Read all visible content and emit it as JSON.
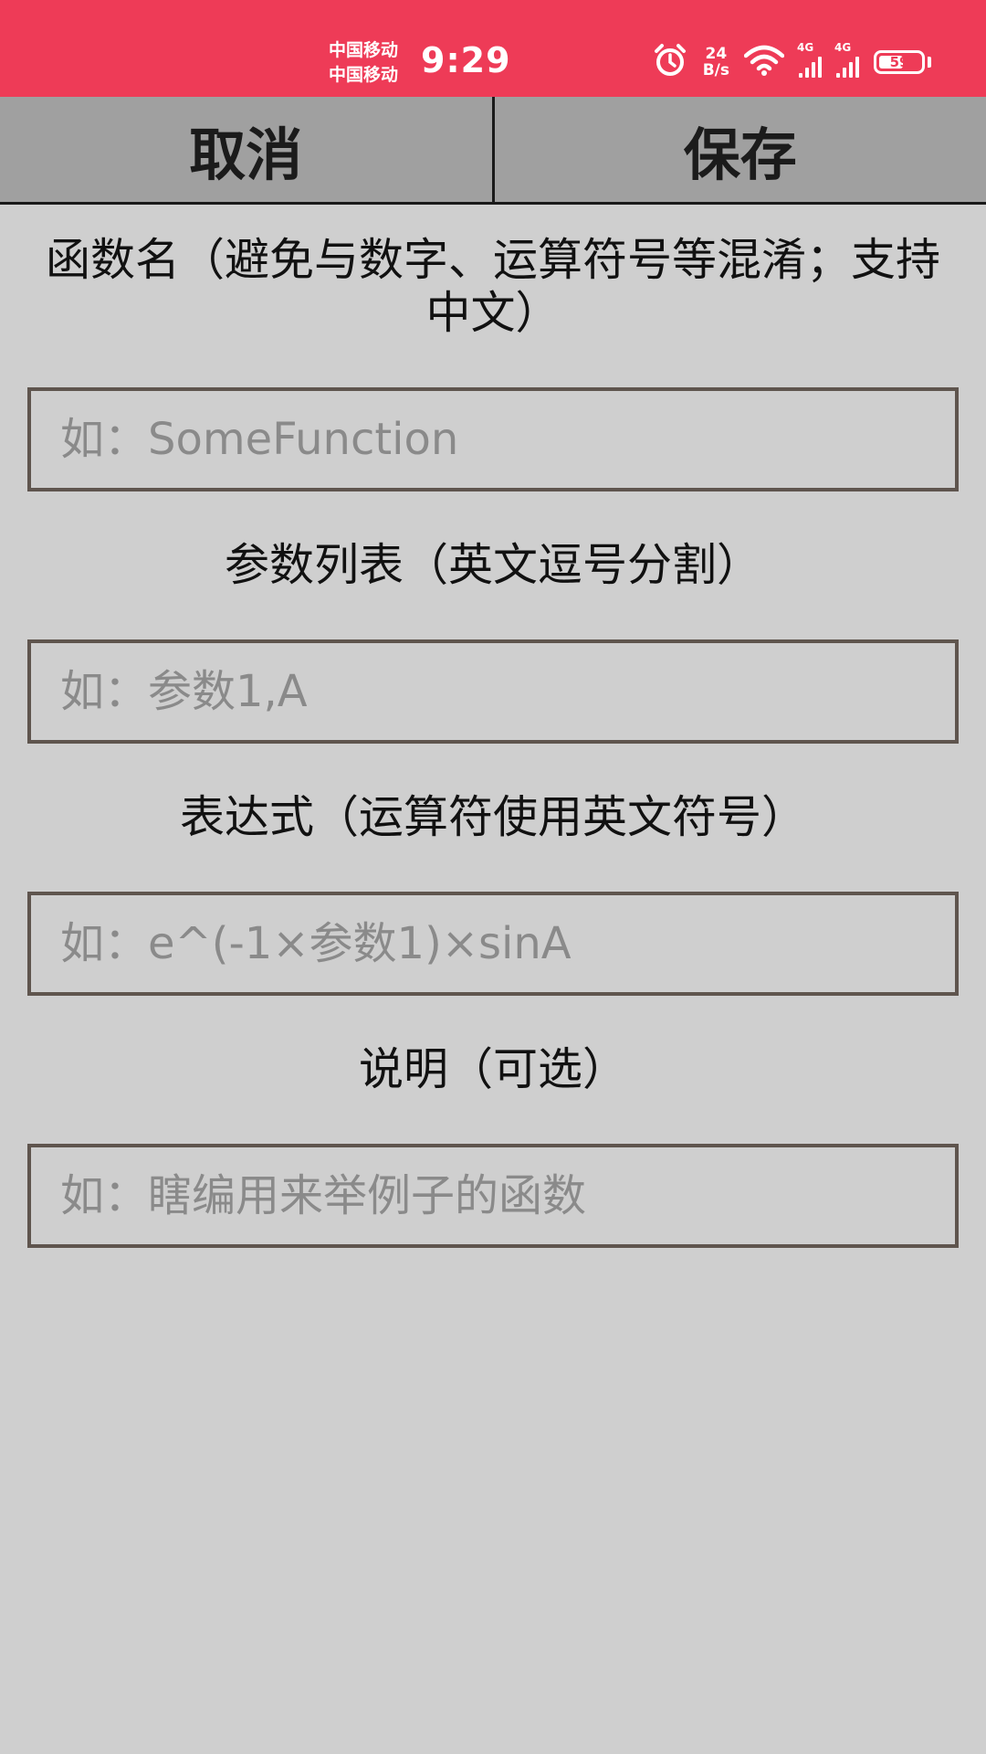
{
  "status_bar": {
    "carrier_1": "中国移动",
    "carrier_2": "中国移动",
    "time": "9:29",
    "net_speed_value": "24",
    "net_speed_unit": "B/s",
    "signal_1_type": "4G",
    "signal_2_type": "4G",
    "battery": "59",
    "battery_level": 0.59,
    "color": "#ee3b57"
  },
  "toolbar": {
    "cancel_label": "取消",
    "save_label": "保存"
  },
  "form": {
    "function_name": {
      "label": "函数名（避免与数字、运算符号等混淆；支持中文）",
      "placeholder": "如：SomeFunction"
    },
    "parameters": {
      "label": "参数列表（英文逗号分割）",
      "placeholder": "如：参数1,A"
    },
    "expression": {
      "label": "表达式（运算符使用英文符号）",
      "placeholder": "如：e^(-1×参数1)×sinA"
    },
    "description": {
      "label": "说明（可选）",
      "placeholder": "如：瞎编用来举例子的函数"
    }
  }
}
